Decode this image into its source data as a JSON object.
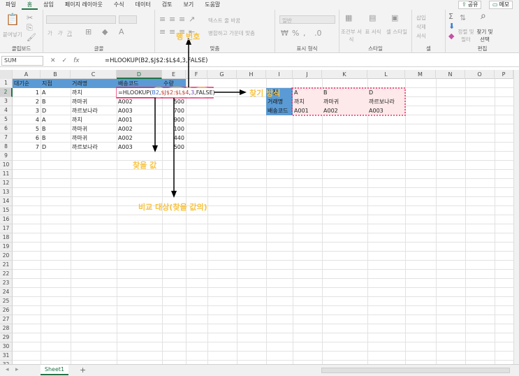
{
  "menu": {
    "items": [
      "파일",
      "홈",
      "삽입",
      "페이지 레이아웃",
      "수식",
      "데이터",
      "검토",
      "보기",
      "도움말"
    ],
    "share": "공유",
    "memo": "메모"
  },
  "ribbon": {
    "clipboard": {
      "label": "클립보드",
      "paste": "붙여넣기"
    },
    "font": {
      "label": "글꼴",
      "bold": "가",
      "italic": "가",
      "underline": "가"
    },
    "align": {
      "label": "맞춤",
      "wrap": "텍스트 줄 바꿈",
      "merge": "병합하고 가운데 맞춤"
    },
    "number": {
      "label": "표시 형식",
      "format": "일반"
    },
    "styles": {
      "label": "스타일",
      "cond": "조건부 서식",
      "table": "표 서식",
      "cell": "셀 스타일"
    },
    "cells": {
      "label": "셀",
      "insert": "삽입",
      "delete": "삭제",
      "format": "서식"
    },
    "edit": {
      "label": "편집",
      "sort": "정렬 및 필터",
      "find": "찾기 및 선택"
    }
  },
  "formula_bar": {
    "name_box": "SUM",
    "cancel": "✕",
    "enter": "✓",
    "fx": "fx",
    "formula": "=HLOOKUP(B2,$J$2:$L$4,3,FALSE)"
  },
  "columns": [
    "A",
    "B",
    "C",
    "D",
    "E",
    "F",
    "G",
    "H",
    "I",
    "J",
    "K",
    "L",
    "M",
    "N",
    "O",
    "P"
  ],
  "rows": [
    "1",
    "2",
    "3",
    "4",
    "5",
    "6",
    "7",
    "8",
    "9",
    "10",
    "11",
    "12",
    "13",
    "14",
    "15",
    "16",
    "17",
    "18",
    "19",
    "20",
    "21",
    "22",
    "23",
    "24",
    "25",
    "26",
    "27",
    "28",
    "29",
    "30",
    "31",
    "32"
  ],
  "table": {
    "headers": [
      "대기순",
      "지점",
      "거래명",
      "배송코드",
      "수량"
    ],
    "rows": [
      {
        "a": "1",
        "b": "A",
        "c": "까치",
        "d": "=HLOOKUP(B2,$J$2:$L$4,3,FALSE)",
        "e": ""
      },
      {
        "a": "2",
        "b": "B",
        "c": "까마귀",
        "d": "A002",
        "e": "500"
      },
      {
        "a": "3",
        "b": "D",
        "c": "까르보나라",
        "d": "A003",
        "e": "700"
      },
      {
        "a": "4",
        "b": "A",
        "c": "까치",
        "d": "A001",
        "e": "900"
      },
      {
        "a": "5",
        "b": "B",
        "c": "까마귀",
        "d": "A002",
        "e": "100"
      },
      {
        "a": "6",
        "b": "B",
        "c": "까마귀",
        "d": "A002",
        "e": "440"
      },
      {
        "a": "7",
        "b": "D",
        "c": "까르보나라",
        "d": "A003",
        "e": "500"
      }
    ]
  },
  "lookup": {
    "labels": [
      "지점",
      "거래명",
      "배송코드"
    ],
    "row1": [
      "A",
      "B",
      "D"
    ],
    "row2": [
      "까치",
      "까마귀",
      "까르보나라"
    ],
    "row3": [
      "A001",
      "A002",
      "A003"
    ]
  },
  "formula_parts": {
    "p1": "=HLOOKUP(",
    "p2": "B2",
    "p3": ",",
    "p4": "$J$2:$L$4",
    "p5": ",",
    "p6": "3",
    "p7": ",FALSE)"
  },
  "annotations": {
    "row_index": "행 번호",
    "match_type": "찾기 방식",
    "lookup_value": "찾을 값",
    "compare_target": "비교 대상(찾을 값의)"
  },
  "colors": {
    "accent": "#217346",
    "header_blue": "#5b9bd5",
    "anno_yellow": "#f6c343",
    "anno_pink": "#e8336b"
  },
  "sheet_tab": "Sheet1",
  "add_sheet": "+"
}
